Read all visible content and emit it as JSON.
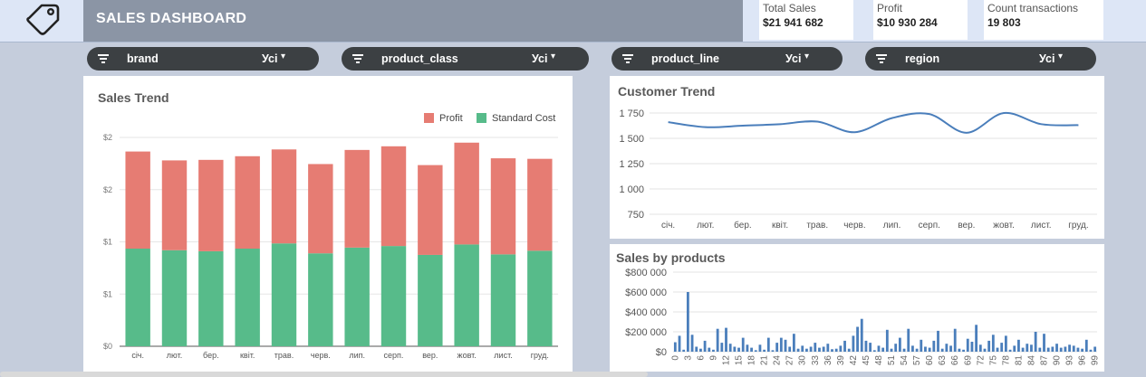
{
  "header": {
    "title": "SALES DASHBOARD",
    "logo_icon": "price-tag-icon"
  },
  "kpis": [
    {
      "label": "Total Sales",
      "value": "$21 941 682"
    },
    {
      "label": "Profit",
      "value": "$10 930 284"
    },
    {
      "label": "Count transactions",
      "value": "19 803"
    }
  ],
  "filters": [
    {
      "name": "brand",
      "value": "Усі"
    },
    {
      "name": "product_class",
      "value": "Усі"
    },
    {
      "name": "product_line",
      "value": "Усі"
    },
    {
      "name": "region",
      "value": "Усі"
    }
  ],
  "colors": {
    "profit": "#e67c73",
    "standard_cost": "#57bb8a",
    "line": "#4a7ebb",
    "title_bar": "#8b95a5",
    "filter_bg": "#3c4043"
  },
  "chart_data": [
    {
      "id": "sales_trend",
      "type": "bar",
      "stacked": true,
      "title": "Sales Trend",
      "categories": [
        "січ.",
        "лют.",
        "бер.",
        "квіт.",
        "трав.",
        "черв.",
        "лип.",
        "серп.",
        "вер.",
        "жовт.",
        "лист.",
        "груд."
      ],
      "series": [
        {
          "name": "Standard Cost",
          "color": "#57bb8a",
          "values": [
            0.935,
            0.92,
            0.91,
            0.935,
            0.985,
            0.89,
            0.945,
            0.96,
            0.875,
            0.975,
            0.88,
            0.915
          ]
        },
        {
          "name": "Profit",
          "color": "#e67c73",
          "values": [
            0.93,
            0.86,
            0.875,
            0.885,
            0.9,
            0.855,
            0.935,
            0.955,
            0.86,
            0.975,
            0.92,
            0.88
          ]
        }
      ],
      "y_ticks": [
        "$0",
        "$1",
        "$1",
        "$2",
        "$2"
      ],
      "ylim": [
        0,
        2
      ],
      "legend": "top-right",
      "grid": true
    },
    {
      "id": "customer_trend",
      "type": "line",
      "title": "Customer Trend",
      "categories": [
        "січ.",
        "лют.",
        "бер.",
        "квіт.",
        "трав.",
        "черв.",
        "лип.",
        "серп.",
        "вер.",
        "жовт.",
        "лист.",
        "груд."
      ],
      "values": [
        1660,
        1610,
        1625,
        1640,
        1665,
        1560,
        1700,
        1740,
        1555,
        1750,
        1640,
        1630
      ],
      "y_ticks": [
        "750",
        "1 000",
        "1 250",
        "1 500",
        "1 750"
      ],
      "ylim": [
        700,
        1800
      ],
      "grid": true
    },
    {
      "id": "sales_by_products",
      "type": "bar",
      "title": "Sales by products",
      "x_tick_labels": [
        "0",
        "3",
        "6",
        "9",
        "12",
        "15",
        "18",
        "21",
        "24",
        "27",
        "30",
        "33",
        "36",
        "39",
        "42",
        "45",
        "48",
        "51",
        "54",
        "57",
        "60",
        "63",
        "66",
        "69",
        "72",
        "75",
        "78",
        "81",
        "84",
        "87",
        "90",
        "93",
        "96",
        "99"
      ],
      "values": [
        95000,
        160000,
        20000,
        600000,
        170000,
        50000,
        30000,
        110000,
        40000,
        20000,
        230000,
        90000,
        240000,
        80000,
        50000,
        40000,
        140000,
        70000,
        40000,
        15000,
        70000,
        20000,
        140000,
        15000,
        90000,
        140000,
        120000,
        50000,
        180000,
        30000,
        60000,
        30000,
        50000,
        90000,
        40000,
        50000,
        80000,
        25000,
        30000,
        60000,
        110000,
        30000,
        160000,
        250000,
        330000,
        110000,
        90000,
        15000,
        60000,
        40000,
        220000,
        30000,
        80000,
        140000,
        30000,
        230000,
        60000,
        30000,
        120000,
        50000,
        40000,
        110000,
        210000,
        30000,
        80000,
        60000,
        230000,
        30000,
        20000,
        130000,
        100000,
        270000,
        70000,
        30000,
        110000,
        170000,
        40000,
        90000,
        160000,
        20000,
        60000,
        120000,
        40000,
        80000,
        70000,
        200000,
        40000,
        180000,
        40000,
        50000,
        80000,
        40000,
        50000,
        70000,
        60000,
        40000,
        30000,
        120000,
        20000,
        50000
      ],
      "y_ticks": [
        "$0",
        "$200 000",
        "$400 000",
        "$600 000",
        "$800 000"
      ],
      "ylim": [
        0,
        800000
      ],
      "grid": true
    }
  ]
}
